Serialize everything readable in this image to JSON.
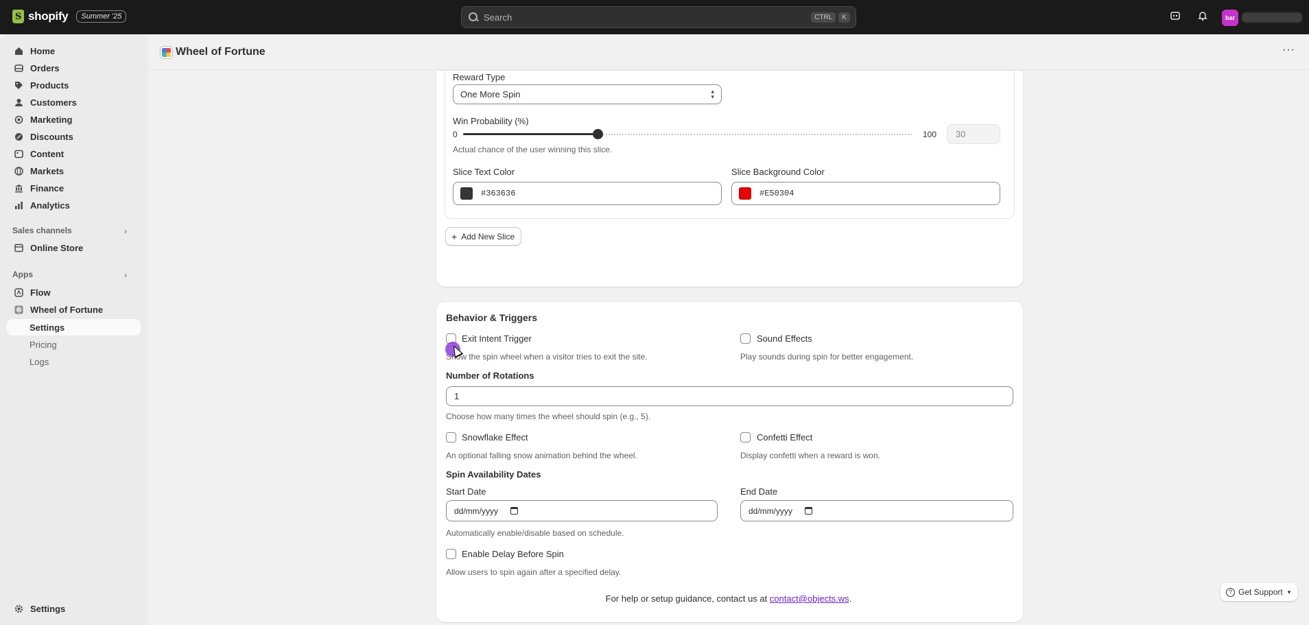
{
  "topbar": {
    "brand": "shopify",
    "edition_badge": "Summer '25",
    "search_placeholder": "Search",
    "shortcut_ctrl": "CTRL",
    "shortcut_k": "K",
    "avatar_initials": "bar"
  },
  "sidebar": {
    "nav": [
      {
        "label": "Home",
        "icon": "home-icon"
      },
      {
        "label": "Orders",
        "icon": "orders-icon"
      },
      {
        "label": "Products",
        "icon": "tag-icon"
      },
      {
        "label": "Customers",
        "icon": "person-icon"
      },
      {
        "label": "Marketing",
        "icon": "target-icon"
      },
      {
        "label": "Discounts",
        "icon": "discount-icon"
      },
      {
        "label": "Content",
        "icon": "content-icon"
      },
      {
        "label": "Markets",
        "icon": "globe-icon"
      },
      {
        "label": "Finance",
        "icon": "bank-icon"
      },
      {
        "label": "Analytics",
        "icon": "chart-icon"
      }
    ],
    "sales_channels_title": "Sales channels",
    "online_store": "Online Store",
    "apps_title": "Apps",
    "flow": "Flow",
    "wheel": "Wheel of Fortune",
    "wheel_sub": [
      "Settings",
      "Pricing",
      "Logs"
    ],
    "settings": "Settings"
  },
  "page": {
    "title": "Wheel of Fortune",
    "more": "···"
  },
  "slice": {
    "reward_type_label": "Reward Type",
    "reward_type_value": "One More Spin",
    "win_prob_label": "Win Probability (%)",
    "slider_min": "0",
    "slider_max": "100",
    "slider_value": "30",
    "slider_fraction": 0.3,
    "win_prob_help": "Actual chance of the user winning this slice.",
    "text_color_label": "Slice Text Color",
    "text_color_value": "#363636",
    "bg_color_label": "Slice Background Color",
    "bg_color_value": "#E50304",
    "add_slice_label": "Add New Slice"
  },
  "behavior": {
    "title": "Behavior & Triggers",
    "exit_intent_label": "Exit Intent Trigger",
    "exit_intent_help": "Show the spin wheel when a visitor tries to exit the site.",
    "sound_label": "Sound Effects",
    "sound_help": "Play sounds during spin for better engagement.",
    "rotations_label": "Number of Rotations",
    "rotations_value": "1",
    "rotations_help": "Choose how many times the wheel should spin (e.g., 5).",
    "snow_label": "Snowflake Effect",
    "snow_help": "An optional falling snow animation behind the wheel.",
    "confetti_label": "Confetti Effect",
    "confetti_help": "Display confetti when a reward is won.",
    "dates_title": "Spin Availability Dates",
    "start_label": "Start Date",
    "start_placeholder": "dd/mm/yyyy",
    "end_label": "End Date",
    "end_placeholder": "dd/mm/yyyy",
    "dates_help": "Automatically enable/disable based on schedule.",
    "delay_label": "Enable Delay Before Spin",
    "delay_help": "Allow users to spin again after a specified delay."
  },
  "footer": {
    "text": "For help or setup guidance, contact us at ",
    "email": "contact@objects.ws",
    "period": ".",
    "support_label": "Get Support"
  }
}
